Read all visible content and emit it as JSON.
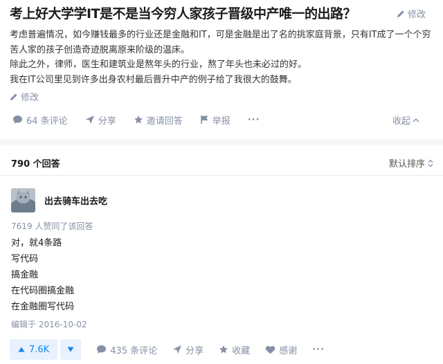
{
  "question": {
    "title": "考上好大学学IT是不是当今穷人家孩子晋级中产唯一的出路？",
    "edit_top_label": "修改",
    "body": [
      "考虑普遍情况，如今赚钱最多的行业还是金融和IT，可是金融是出了名的挑家庭背景，只有IT成了一个个穷苦人家的孩子创造奇迹脱离原来阶级的温床。",
      "除此之外，律师，医生和建筑业是熬年头的行业，熬了年头也未必过的好。",
      "我在IT公司里见到许多出身农村最后晋升中产的例子给了我很大的鼓舞。"
    ],
    "edit_bottom_label": "修改",
    "actions": {
      "comments": "64 条评论",
      "share": "分享",
      "invite": "邀请回答",
      "report": "举报",
      "more": "···",
      "collapse": "收起"
    }
  },
  "answers": {
    "count_label": "790 个回答",
    "sort_label": "默认排序"
  },
  "answer": {
    "author": "出去骑车出去吃",
    "votes_line": "7619 人赞同了该回答",
    "lines": [
      "对，就4条路",
      "写代码",
      "搞金融",
      "在代码圈搞金融",
      "在金融圈写代码"
    ],
    "edited": "编辑于 2016-10-02",
    "actions": {
      "upvote": "7.6K",
      "comments": "435 条评论",
      "share": "分享",
      "collect": "收藏",
      "thanks": "感谢",
      "more": "···"
    }
  },
  "colors": {
    "accent": "#0f88eb",
    "meta": "#8590a6",
    "vote_bg": "#e8f1fd"
  }
}
